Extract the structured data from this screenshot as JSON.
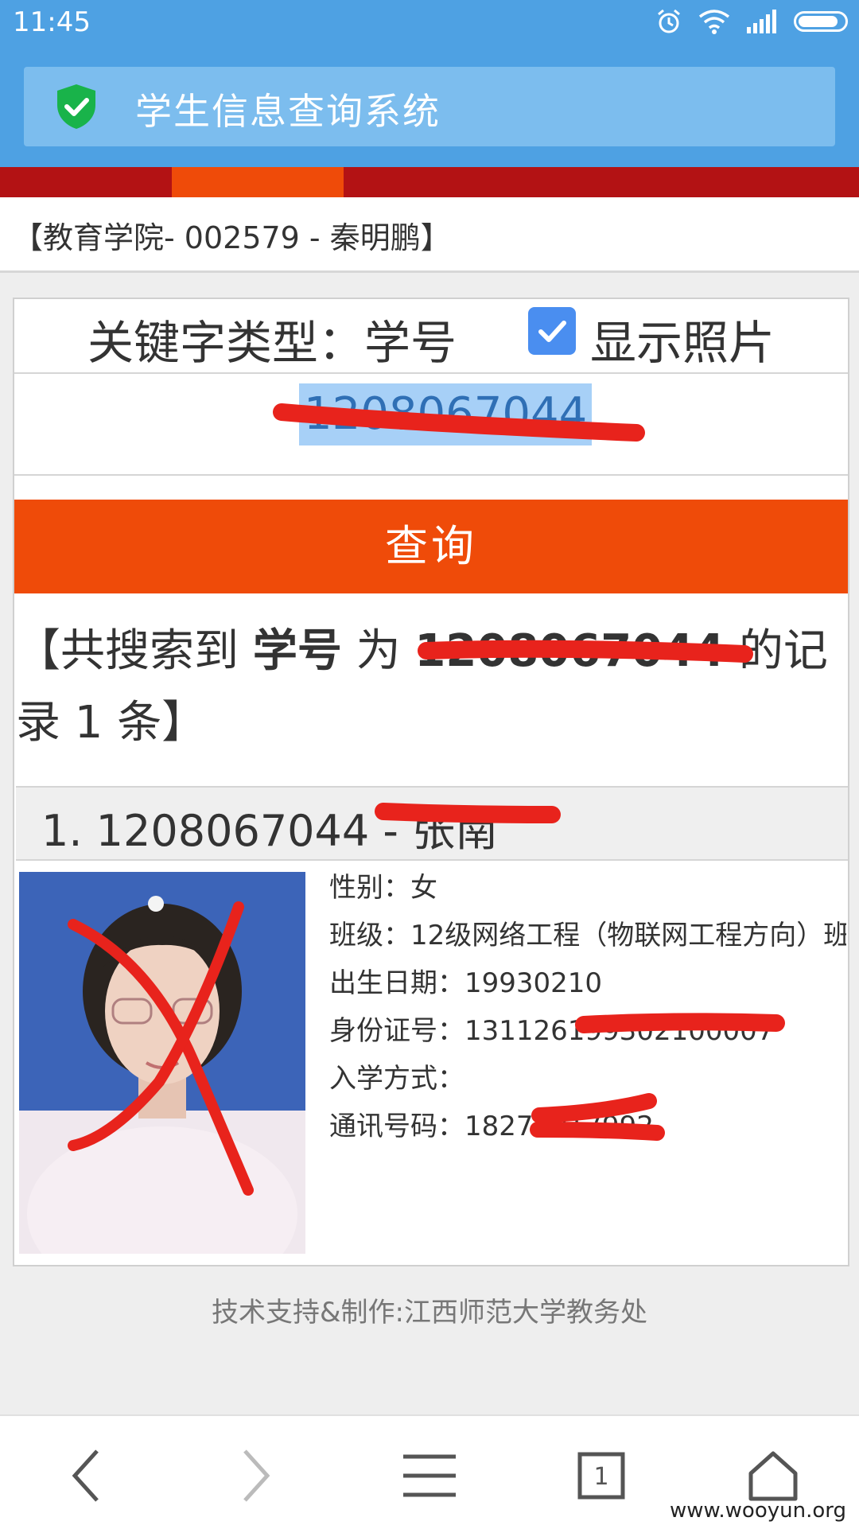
{
  "status_bar": {
    "time": "11:45"
  },
  "browser": {
    "title": "学生信息查询系统"
  },
  "user": {
    "info": "【教育学院- 002579 - 秦明鹏】"
  },
  "search": {
    "keyword_label": "关键字类型：学号",
    "show_photo_label": "显示照片",
    "show_photo_checked": true,
    "input_value": "1208067044",
    "query_button": "查询"
  },
  "result": {
    "prefix": "【共搜索到 ",
    "field": "学号",
    "middle": " 为 ",
    "value": "1208067044",
    "suffix": " 的记录 1 条】"
  },
  "record": {
    "title": "1. 1208067044 - 张南",
    "gender": "性别：女",
    "class": "班级：12级网络工程（物联网工程方向）班",
    "birth": "出生日期：19930210",
    "id_number": "身份证号：131126199302100007",
    "enroll": "入学方式：",
    "phone": "通讯号码：18270017992"
  },
  "footer": {
    "credit": "技术支持&制作:江西师范大学教务处"
  },
  "nav": {
    "tabs_count": "1"
  },
  "watermark": "www.wooyun.org",
  "colors": {
    "header_blue": "#4ea1e3",
    "accent_orange": "#ef4b09",
    "strip_red": "#b31214",
    "redaction_red": "#e8231c"
  }
}
